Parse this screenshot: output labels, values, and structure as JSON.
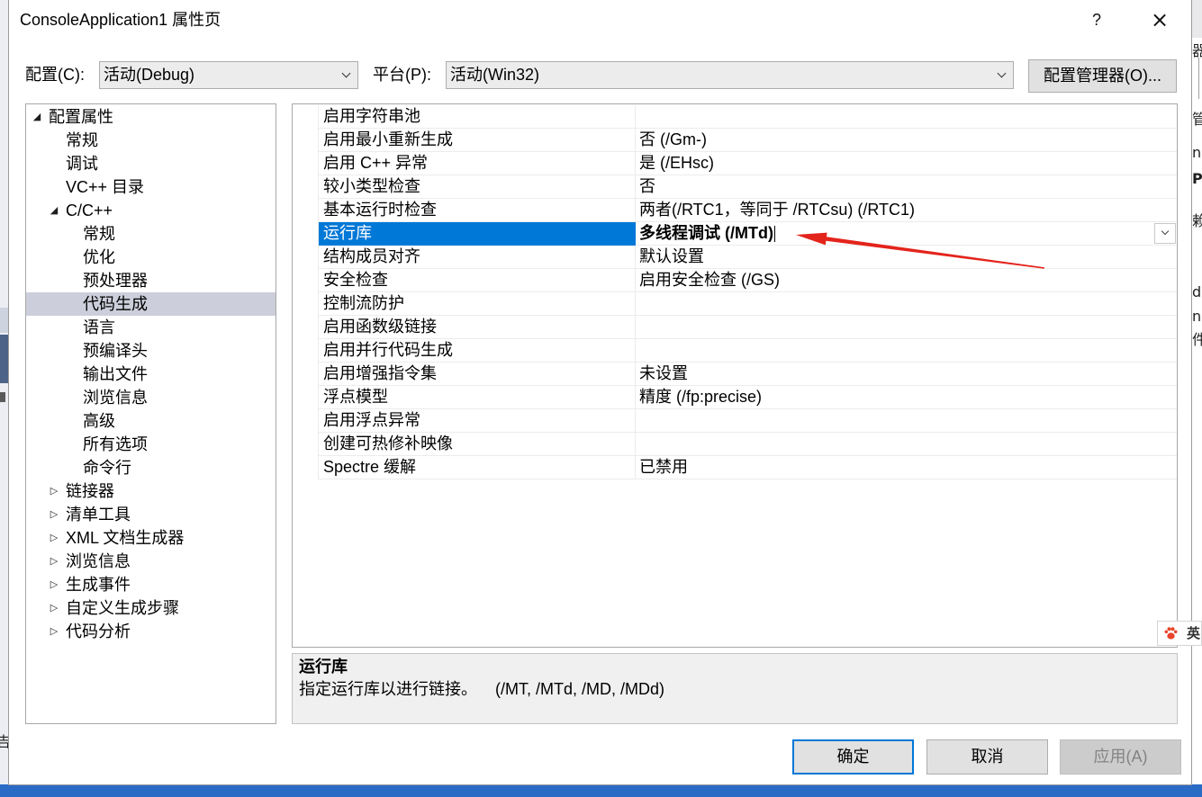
{
  "window": {
    "title": "ConsoleApplication1 属性页",
    "help_label": "?",
    "close_label": "×"
  },
  "config_bar": {
    "configuration_label": "配置(C):",
    "configuration_value": "活动(Debug)",
    "platform_label": "平台(P):",
    "platform_value": "活动(Win32)",
    "config_manager_label": "配置管理器(O)..."
  },
  "tree": {
    "root": {
      "label": "配置属性",
      "expanded": true,
      "children": [
        {
          "label": "常规"
        },
        {
          "label": "调试"
        },
        {
          "label": "VC++ 目录"
        },
        {
          "label": "C/C++",
          "expanded": true,
          "children": [
            {
              "label": "常规"
            },
            {
              "label": "优化"
            },
            {
              "label": "预处理器"
            },
            {
              "label": "代码生成",
              "selected": true
            },
            {
              "label": "语言"
            },
            {
              "label": "预编译头"
            },
            {
              "label": "输出文件"
            },
            {
              "label": "浏览信息"
            },
            {
              "label": "高级"
            },
            {
              "label": "所有选项"
            },
            {
              "label": "命令行"
            }
          ]
        },
        {
          "label": "链接器",
          "expanded": false
        },
        {
          "label": "清单工具",
          "expanded": false
        },
        {
          "label": "XML 文档生成器",
          "expanded": false
        },
        {
          "label": "浏览信息",
          "expanded": false
        },
        {
          "label": "生成事件",
          "expanded": false
        },
        {
          "label": "自定义生成步骤",
          "expanded": false
        },
        {
          "label": "代码分析",
          "expanded": false
        }
      ]
    }
  },
  "grid": {
    "rows": [
      {
        "name": "启用字符串池",
        "value": ""
      },
      {
        "name": "启用最小重新生成",
        "value": "否 (/Gm-)"
      },
      {
        "name": "启用 C++ 异常",
        "value": "是 (/EHsc)"
      },
      {
        "name": "较小类型检查",
        "value": "否"
      },
      {
        "name": "基本运行时检查",
        "value": "两者(/RTC1，等同于 /RTCsu) (/RTC1)"
      },
      {
        "name": "运行库",
        "value": "多线程调试 (/MTd)",
        "selected": true
      },
      {
        "name": "结构成员对齐",
        "value": "默认设置"
      },
      {
        "name": "安全检查",
        "value": "启用安全检查 (/GS)"
      },
      {
        "name": "控制流防护",
        "value": ""
      },
      {
        "name": "启用函数级链接",
        "value": ""
      },
      {
        "name": "启用并行代码生成",
        "value": ""
      },
      {
        "name": "启用增强指令集",
        "value": "未设置"
      },
      {
        "name": "浮点模型",
        "value": "精度 (/fp:precise)"
      },
      {
        "name": "启用浮点异常",
        "value": ""
      },
      {
        "name": "创建可热修补映像",
        "value": ""
      },
      {
        "name": "Spectre 缓解",
        "value": "已禁用"
      }
    ]
  },
  "description": {
    "title": "运行库",
    "text": "指定运行库以进行链接。    (/MT, /MTd, /MD, /MDd)"
  },
  "buttons": {
    "ok": "确定",
    "cancel": "取消",
    "apply": "应用(A)"
  },
  "ime": {
    "label": "英",
    "icon": "paw-icon"
  },
  "background_window": {
    "right_edge_fragments": [
      "器",
      "管",
      "ns",
      "P",
      "赖",
      "dr",
      "ns",
      "件"
    ],
    "left_edge_fragments": [
      "吉"
    ]
  },
  "icons": {
    "expanded": "expanded-triangle-icon",
    "collapsed": "collapsed-triangle-icon",
    "dropdown": "chevron-down-icon"
  },
  "colors": {
    "selection_blue": "#0078d7",
    "tree_selection": "#cccedb",
    "annotation_red": "#e3241b",
    "status_strip": "#2a6bc6",
    "disabled_text": "#838383"
  }
}
